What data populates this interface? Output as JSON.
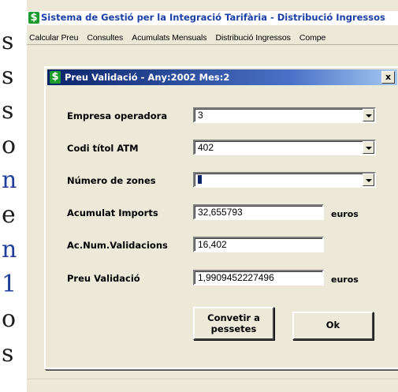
{
  "doc_strip": {
    "chars": [
      "s",
      "s",
      "s",
      "o",
      "n",
      "e",
      "n",
      "1",
      "o",
      "s"
    ]
  },
  "app": {
    "title": "Sistema de Gestió per la Integració Tarifària - Distribució Ingressos",
    "menu": [
      "Calcular Preu",
      "Consultes",
      "Acumulats Mensuals",
      "Distribució Ingressos",
      "Compe"
    ]
  },
  "dialog": {
    "title": "Preu Validació - Any:2002 Mes:2",
    "close_label": "x",
    "fields": {
      "empresa": {
        "label": "Empresa operadora",
        "value": "3"
      },
      "codi": {
        "label": "Codi títol ATM",
        "value": "402"
      },
      "zones": {
        "label": "Número de zones",
        "value": ""
      },
      "imports": {
        "label": "Acumulat Imports",
        "value": "32,655793",
        "unit": "euros"
      },
      "validacions": {
        "label": "Ac.Num.Validacions",
        "value": "16,402"
      },
      "preu": {
        "label": "Preu Validació",
        "value": "1,9909452227496",
        "unit": "euros"
      }
    },
    "buttons": {
      "convert_line1": "Convetir a",
      "convert_line2": "pessetes",
      "ok": "Ok"
    }
  },
  "colors": {
    "accent_green": "#1e9b2e",
    "title_blue": "#1a3fa6",
    "dialog_title_bg": "#0a246a",
    "window_bg": "#ece9d8"
  }
}
